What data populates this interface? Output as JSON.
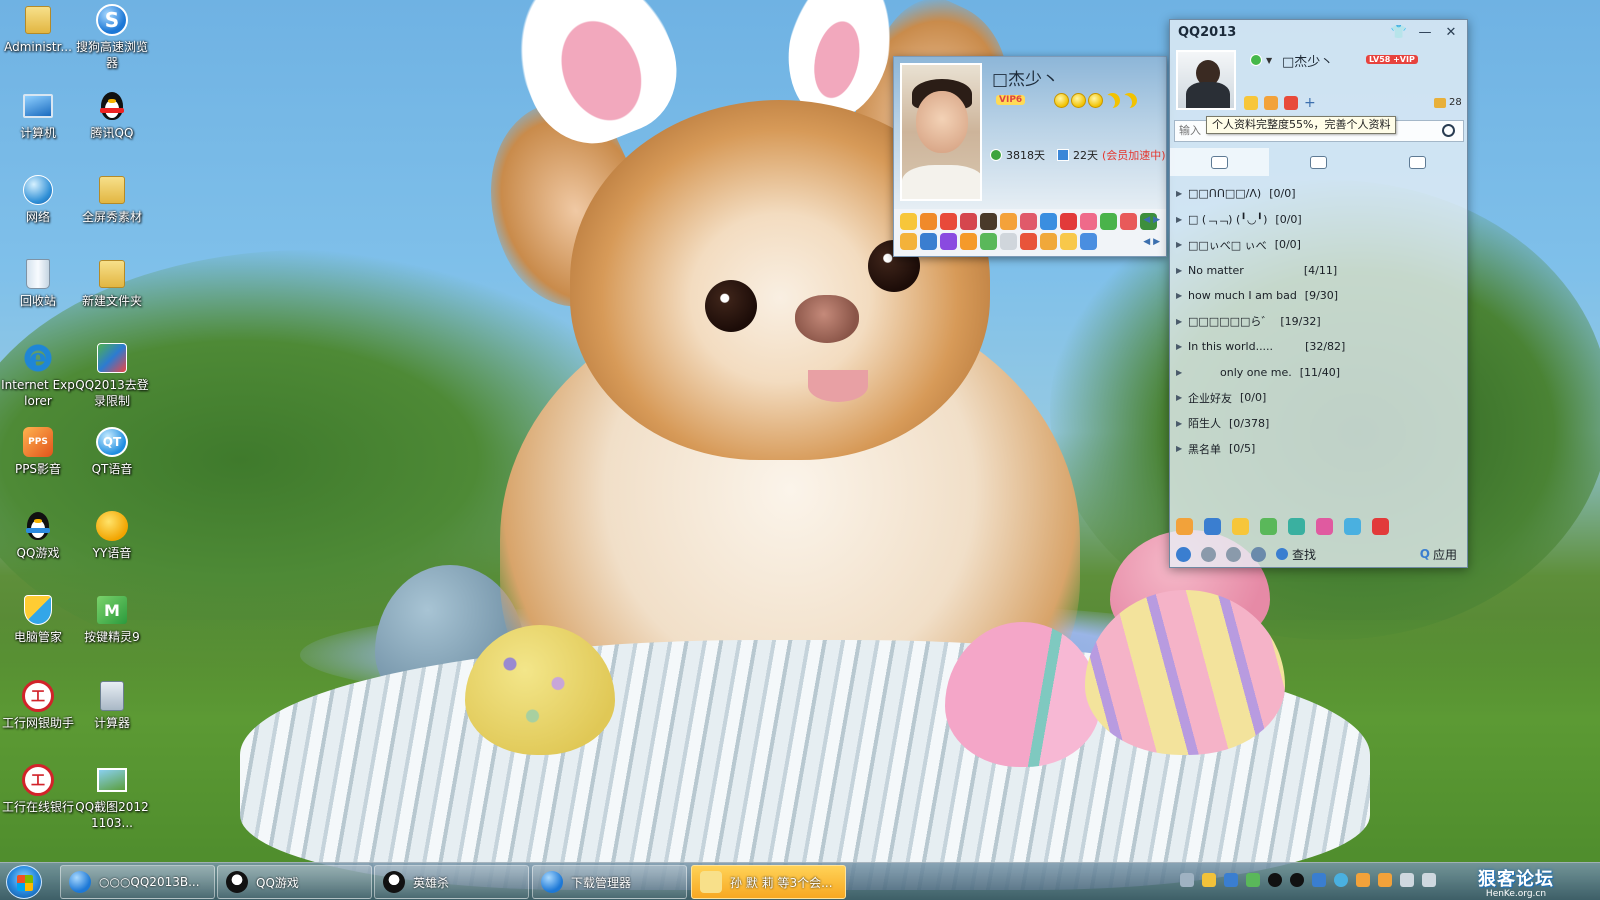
{
  "desktop": {
    "icons": [
      {
        "label": "Administr...",
        "icon": "folder-user-icon"
      },
      {
        "label": "搜狗高速浏览器",
        "icon": "sogou-browser-icon"
      },
      {
        "label": "计算机",
        "icon": "computer-icon"
      },
      {
        "label": "腾讯QQ",
        "icon": "qq-penguin-icon"
      },
      {
        "label": "网络",
        "icon": "network-icon"
      },
      {
        "label": "全屏秀素材",
        "icon": "folder-icon"
      },
      {
        "label": "回收站",
        "icon": "recycle-bin-icon"
      },
      {
        "label": "新建文件夹",
        "icon": "folder-icon"
      },
      {
        "label": "Internet Explorer",
        "icon": "internet-explorer-icon"
      },
      {
        "label": "QQ2013去登录限制",
        "icon": "archive-icon"
      },
      {
        "label": "PPS影音",
        "icon": "pps-player-icon"
      },
      {
        "label": "QT语音",
        "icon": "qt-voice-icon"
      },
      {
        "label": "QQ游戏",
        "icon": "qq-game-icon"
      },
      {
        "label": "YY语音",
        "icon": "yy-voice-icon"
      },
      {
        "label": "电脑管家",
        "icon": "pc-manager-icon"
      },
      {
        "label": "按键精灵9",
        "icon": "key-wizard-icon"
      },
      {
        "label": "工行网银助手",
        "icon": "icbc-icon"
      },
      {
        "label": "计算器",
        "icon": "calculator-icon"
      },
      {
        "label": "工行在线银行",
        "icon": "icbc-icon"
      },
      {
        "label": "QQ截图20121103...",
        "icon": "screenshot-image-icon"
      }
    ]
  },
  "profile_card": {
    "nickname": "□杰少丶",
    "vip_badge": "VIP6",
    "online_days": "3818天",
    "active_days": "22天",
    "speedup_note": "(会员加速中)"
  },
  "qq_panel": {
    "title": "QQ2013",
    "nickname": "□杰少丶",
    "level_badge": "LV58 +VIP",
    "mail_count": "28",
    "search_placeholder": "输入",
    "tooltip": "个人资料完整度55%，完善个人资料",
    "groups": [
      {
        "name": "□□ՈՈ□□/Λ)",
        "count": "[0/0]"
      },
      {
        "name": "□ (﹁﹁) (╹◡╹)",
        "count": "[0/0]"
      },
      {
        "name": "□□ぃべ□ ぃべ",
        "count": "[0/0]"
      },
      {
        "name": "No matter",
        "count": "[4/11]"
      },
      {
        "name": "how much I am bad",
        "count": "[9/30]"
      },
      {
        "name": "□□□□□□ら゛",
        "count": "[19/32]"
      },
      {
        "name": "In this world.....",
        "count": "[32/82]"
      },
      {
        "name": "only one me.",
        "count": "[11/40]"
      },
      {
        "name": "企业好友",
        "count": "[0/0]"
      },
      {
        "name": "陌生人",
        "count": "[0/378]"
      },
      {
        "name": "黑名单",
        "count": "[0/5]"
      }
    ],
    "find_label": "查找",
    "apps_label": "应用"
  },
  "taskbar": {
    "buttons": [
      {
        "label": "○○○QQ2013B...",
        "icon": "sogou-browser-icon"
      },
      {
        "label": "QQ游戏",
        "icon": "qq-game-icon"
      },
      {
        "label": "英雄杀",
        "icon": "qq-penguin-icon"
      },
      {
        "label": "下载管理器",
        "icon": "sogou-browser-icon"
      },
      {
        "label": "孙 默 莉 等3个会...",
        "icon": "chat-group-icon"
      }
    ],
    "watermark_big": "狠客论坛",
    "watermark_small": "HenKe.org.cn"
  },
  "colors": {
    "accent": "#2a8be0",
    "flash": "#f7a822",
    "vip_red": "#e4362e"
  }
}
